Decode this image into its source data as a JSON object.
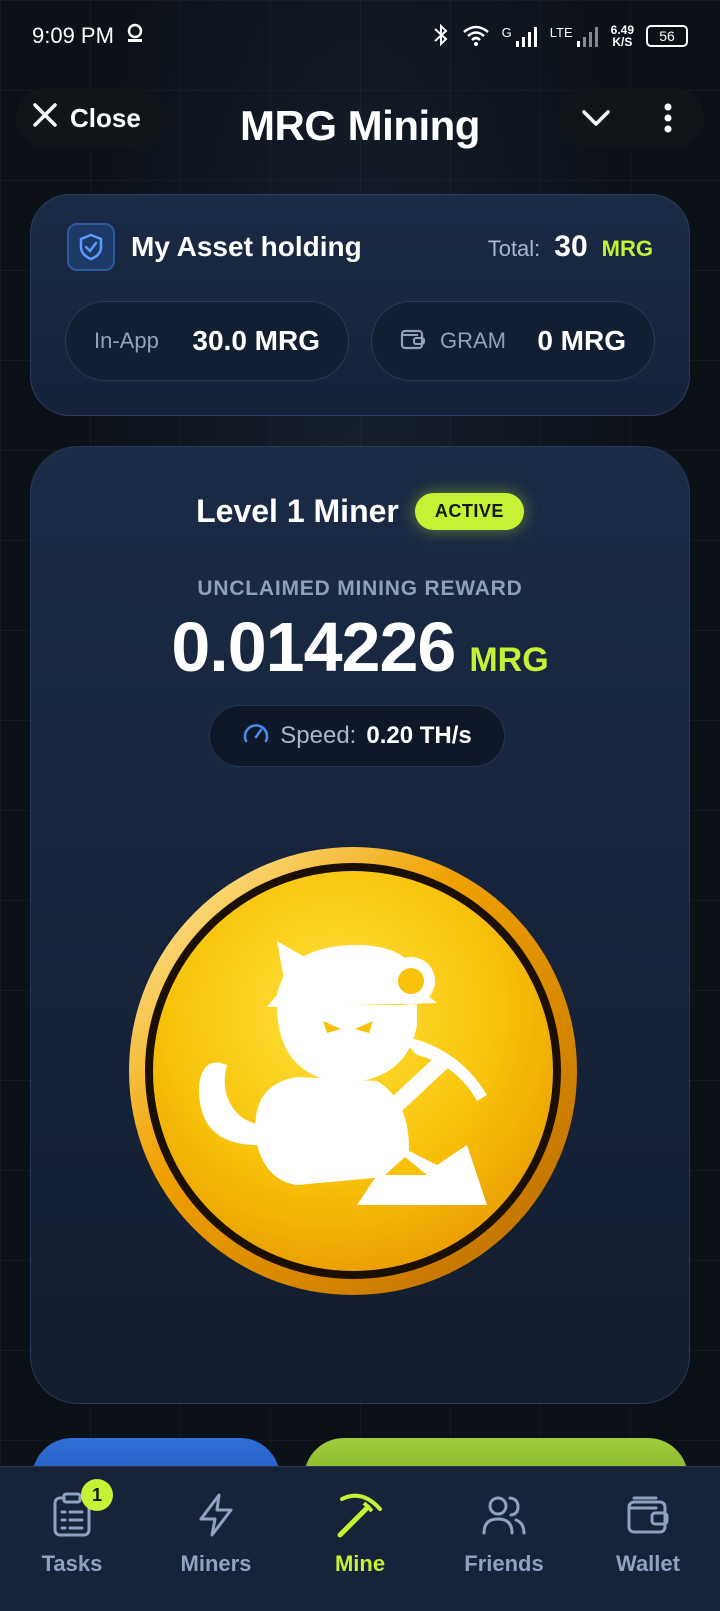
{
  "status_bar": {
    "time": "9:09 PM",
    "network_speed_value": "6.49",
    "network_speed_unit": "K/S",
    "battery": "56",
    "signal_label_1": "G",
    "signal_label_2": "LTE"
  },
  "header": {
    "close_label": "Close",
    "title": "MRG Mining"
  },
  "asset_card": {
    "title": "My Asset holding",
    "total_label": "Total:",
    "total_value": "30",
    "total_unit": "MRG",
    "in_app_label": "In-App",
    "in_app_value": "30.0 MRG",
    "gram_label": "GRAM",
    "gram_value": "0 MRG"
  },
  "miner_card": {
    "level": "Level 1 Miner",
    "status": "ACTIVE",
    "reward_label": "UNCLAIMED MINING REWARD",
    "reward_value": "0.014226",
    "reward_unit": "MRG",
    "speed_label": "Speed:",
    "speed_value": "0.20 TH/s"
  },
  "bottom_nav": {
    "items": [
      {
        "label": "Tasks",
        "icon": "clipboard-icon",
        "badge": "1"
      },
      {
        "label": "Miners",
        "icon": "lightning-icon"
      },
      {
        "label": "Mine",
        "icon": "pickaxe-icon",
        "active": true
      },
      {
        "label": "Friends",
        "icon": "users-icon"
      },
      {
        "label": "Wallet",
        "icon": "wallet-icon"
      }
    ]
  },
  "colors": {
    "accent_green": "#c6f135",
    "card_bg": "#1b2a45",
    "nav_bg": "#172338",
    "coin_gold": "#f5b800"
  }
}
